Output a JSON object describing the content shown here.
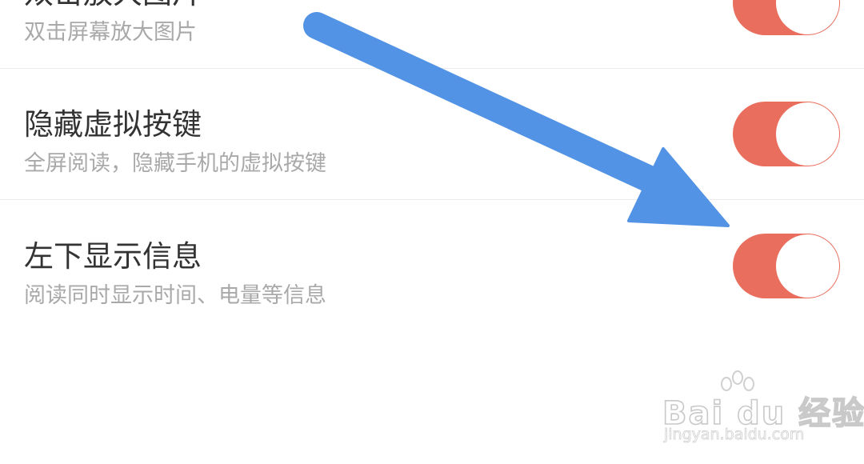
{
  "settings": [
    {
      "title": "双击放大图片",
      "description": "双击屏幕放大图片",
      "enabled": true
    },
    {
      "title": "隐藏虚拟按键",
      "description": "全屏阅读，隐藏手机的虚拟按键",
      "enabled": true
    },
    {
      "title": "左下显示信息",
      "description": "阅读同时显示时间、电量等信息",
      "enabled": true
    }
  ],
  "colors": {
    "toggle_on": "#ea6e5d",
    "arrow": "#5293e5",
    "title_text": "#333333",
    "description_text": "#a9a9a9"
  },
  "annotation": {
    "icon": "arrow-icon"
  },
  "watermark": {
    "logo": "Bai du 经验",
    "url": "jingyan.baidu.com"
  }
}
